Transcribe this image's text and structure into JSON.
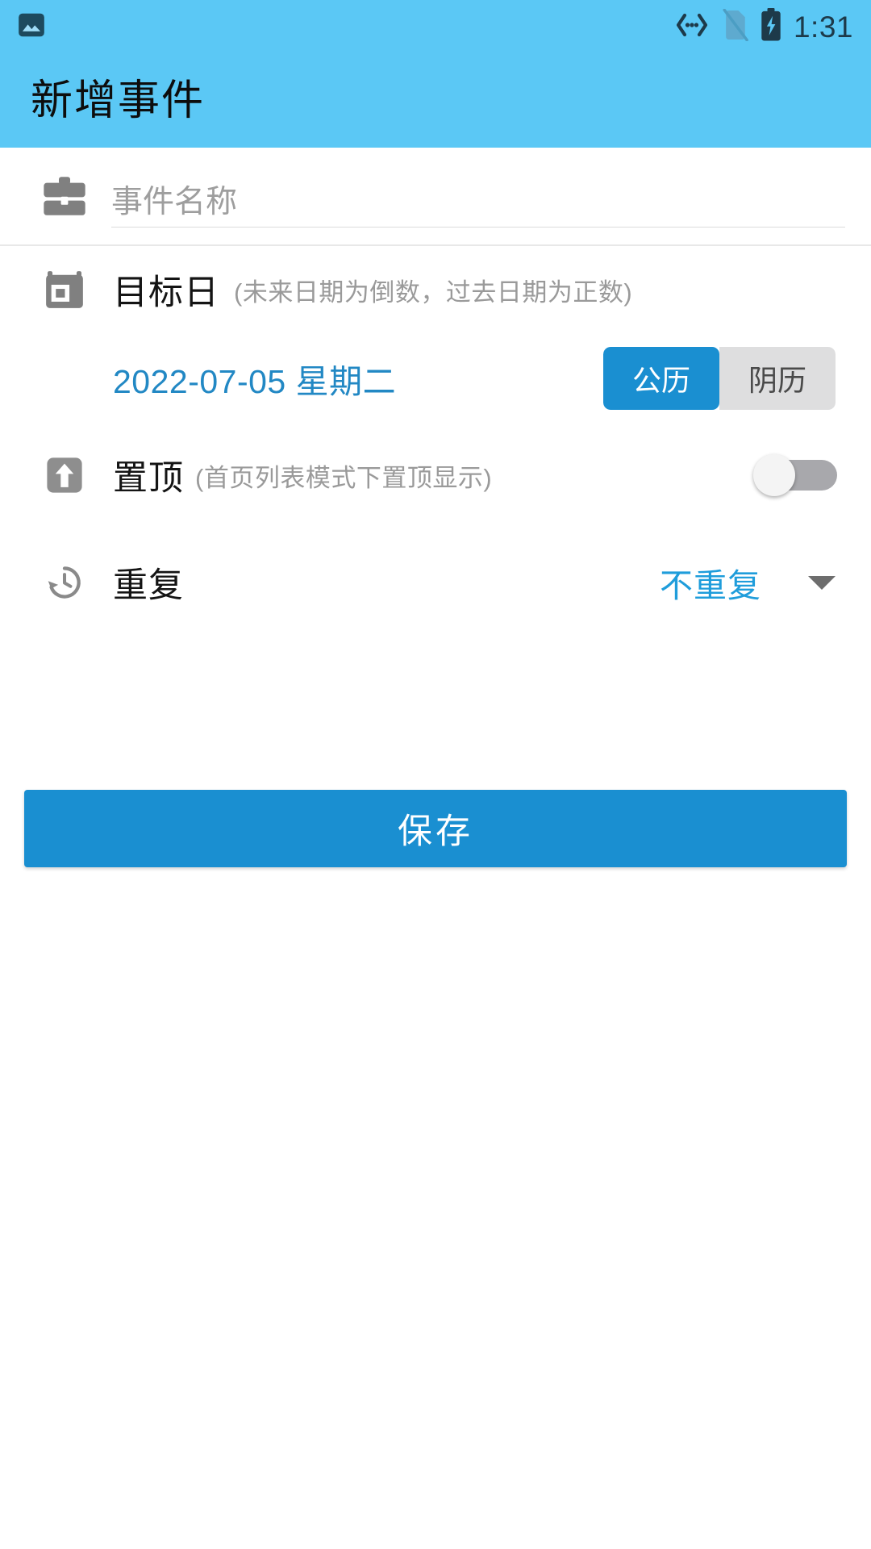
{
  "status_bar": {
    "notification_icon": "image-icon",
    "usb_debug_icon": "usb-debugging-icon",
    "sim_icon": "no-sim-card-icon",
    "battery_icon": "battery-charging-icon",
    "time": "1:31"
  },
  "app_bar": {
    "title": "新增事件",
    "background_color": "#5BC8F5"
  },
  "form": {
    "event_name": {
      "icon": "briefcase-icon",
      "value": "",
      "placeholder": "事件名称"
    },
    "target_date": {
      "icon": "calendar-icon",
      "label": "目标日",
      "hint": "(未来日期为倒数，过去日期为正数)",
      "date_value": "2022-07-05 星期二",
      "calendar_types": [
        {
          "label": "公历",
          "selected": true
        },
        {
          "label": "阴历",
          "selected": false
        }
      ]
    },
    "pin_to_top": {
      "icon": "arrow-up-icon",
      "label": "置顶",
      "hint": "(首页列表模式下置顶显示)",
      "enabled": false
    },
    "repeat": {
      "icon": "history-icon",
      "label": "重复",
      "value": "不重复",
      "caret": "chevron-down-icon"
    }
  },
  "actions": {
    "save_label": "保存"
  },
  "colors": {
    "accent": "#1a8fd1",
    "header": "#5BC8F5",
    "link_blue": "#2288c4",
    "hint_gray": "#9a9a9a"
  }
}
